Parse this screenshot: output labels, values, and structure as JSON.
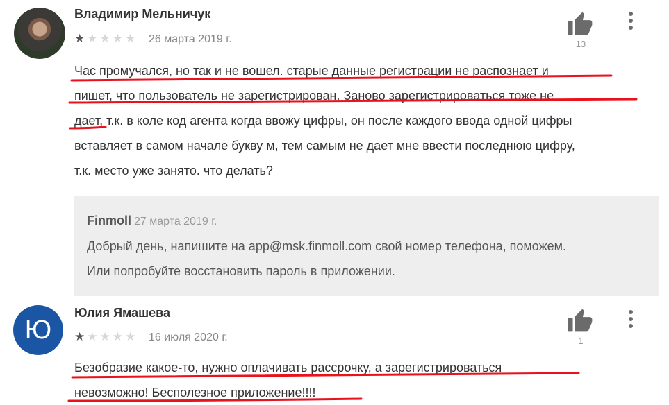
{
  "reviews": [
    {
      "author": "Владимир Мельничук",
      "rating": 1,
      "rating_max": 5,
      "date": "26 марта 2019 г.",
      "likes": "13",
      "lines": [
        "Час промучался, но так и не вошел. старые данные регистрации не распознает и",
        "пишет, что пользователь не зарегистрирован. Заново зарегистрироваться тоже не",
        "дает, т.к. в коле код агента когда ввожу цифры, он после каждого ввода одной цифры",
        "вставляет в самом начале букву м, тем самым не дает мне ввести последнюю цифру,",
        "т.к. место уже занято. что делать?"
      ],
      "reply": {
        "developer": "Finmoll",
        "date": "27 марта 2019 г.",
        "lines": [
          "Добрый день, напишите на app@msk.finmoll.com свой номер телефона, поможем.",
          "Или попробуйте восстановить пароль в приложении."
        ]
      }
    },
    {
      "author": "Юлия Ямашева",
      "avatar_letter": "Ю",
      "rating": 1,
      "rating_max": 5,
      "date": "16 июля 2020 г.",
      "likes": "1",
      "lines": [
        "Безобразие какое-то, нужно оплачивать рассрочку, а зарегистрироваться",
        "невозможно! Бесполезное приложение!!!!"
      ]
    }
  ],
  "colors": {
    "underline": "#e8111c",
    "avatar_bg": "#1a56a3",
    "reply_bg": "#eeeeee"
  },
  "icons": {
    "like": "thumbs-up-icon",
    "more": "more-vert-icon"
  }
}
